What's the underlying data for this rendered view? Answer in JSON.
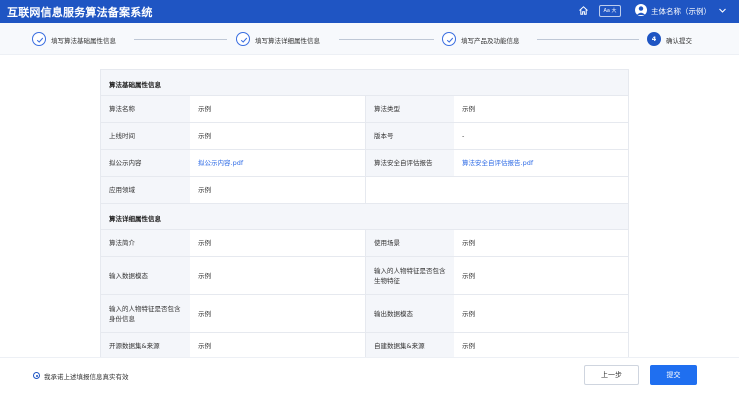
{
  "app": {
    "title": "互联网信息服务算法备案系统",
    "font_toggle": "Aa 大",
    "user_name": "主体名称（示例）",
    "icons": {
      "home": "home-icon",
      "avatar": "user-avatar-icon",
      "dropdown": "chevron-down-icon"
    }
  },
  "steps": [
    {
      "label": "填写算法基础属性信息",
      "status": "done"
    },
    {
      "label": "填写算法详细属性信息",
      "status": "done"
    },
    {
      "label": "填写产品及功能信息",
      "status": "done"
    },
    {
      "label": "确认提交",
      "status": "active",
      "number": "4"
    }
  ],
  "basic_section": {
    "title": "算法基础属性信息",
    "rows": [
      {
        "label1": "算法名称",
        "value1": "示例",
        "label2": "算法类型",
        "value2": "示例"
      },
      {
        "label1": "上线时间",
        "value1": "示例",
        "label2": "版本号",
        "value2": "-"
      },
      {
        "label1": "拟公示内容",
        "value1": "拟公示内容.pdf",
        "label2": "算法安全自评估报告",
        "value2": "算法安全自评估报告.pdf"
      },
      {
        "label1": "应用领域",
        "value1": "示例"
      }
    ]
  },
  "detail_section": {
    "title": "算法详细属性信息",
    "rows": [
      {
        "label1": "算法简介",
        "value1": "示例",
        "label2": "使用场景",
        "value2": "示例"
      },
      {
        "label1": "输入数据模态",
        "value1": "示例",
        "label2": "输入的人物特征是否包含生物特征",
        "value2": "示例"
      },
      {
        "label1": "输入的人物特征是否包含身份信息",
        "value1": "示例",
        "label2": "输出数据模态",
        "value2": "示例"
      },
      {
        "label1": "开源数据集&来源",
        "value1": "示例",
        "label2": "自建数据集&来源",
        "value2": "示例"
      }
    ]
  },
  "footer": {
    "agree_text": "我承诺上述填报信息真实有效",
    "agree_checked": true,
    "prev_label": "上一步",
    "submit_label": "提交"
  },
  "colors": {
    "primary": "#1f55c3",
    "link": "#2e6be6",
    "submit": "#1f6ff0"
  }
}
